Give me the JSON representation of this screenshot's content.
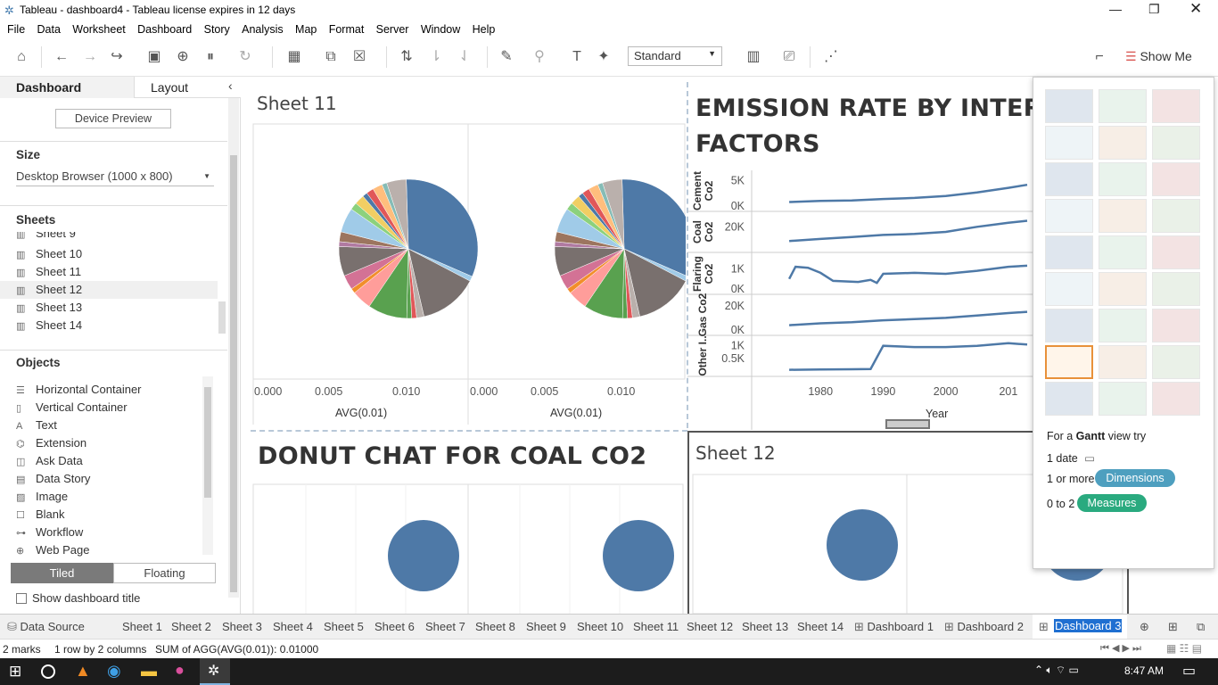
{
  "window": {
    "title": "Tableau - dashboard4 - Tableau license expires in 12 days"
  },
  "menu": [
    "File",
    "Data",
    "Worksheet",
    "Dashboard",
    "Story",
    "Analysis",
    "Map",
    "Format",
    "Server",
    "Window",
    "Help"
  ],
  "toolbar": {
    "view_mode": "Standard",
    "show_me_label": "Show Me"
  },
  "left_panel": {
    "tabs": [
      "Dashboard",
      "Layout"
    ],
    "device_preview": "Device Preview",
    "size_header": "Size",
    "size_value": "Desktop Browser (1000 x 800)",
    "sheets_header": "Sheets",
    "sheets": [
      "Sheet 9",
      "Sheet 10",
      "Sheet 11",
      "Sheet 12",
      "Sheet 13",
      "Sheet 14"
    ],
    "objects_header": "Objects",
    "objects": [
      "Horizontal Container",
      "Vertical Container",
      "Text",
      "Extension",
      "Ask Data",
      "Data Story",
      "Image",
      "Blank",
      "Workflow",
      "Web Page"
    ],
    "tiled": "Tiled",
    "floating": "Floating",
    "show_title": "Show dashboard title"
  },
  "dashboard": {
    "sheet11_title": "Sheet 11",
    "emission_title_line1": "EMISSION RATE BY INTERNA",
    "emission_title_line2": "FACTORS",
    "donut_title": "DONUT CHAT FOR COAL CO2",
    "sheet12_title": "Sheet 12",
    "pie_axis_ticks": [
      "0.000",
      "0.005",
      "0.010"
    ],
    "pie_axis_label": "AVG(0.01)",
    "year_label": "Year",
    "year_ticks": [
      "1980",
      "1990",
      "2000",
      "201"
    ]
  },
  "chart_data": {
    "type": "line",
    "xlabel": "Year",
    "series": [
      {
        "name": "Cement Co2",
        "ticks": [
          "5K",
          "0K"
        ],
        "values": [
          {
            "x": 1975,
            "y": 800
          },
          {
            "x": 1980,
            "y": 1000
          },
          {
            "x": 1985,
            "y": 1100
          },
          {
            "x": 1990,
            "y": 1400
          },
          {
            "x": 1995,
            "y": 1600
          },
          {
            "x": 2000,
            "y": 2000
          },
          {
            "x": 2005,
            "y": 2700
          },
          {
            "x": 2010,
            "y": 3600
          },
          {
            "x": 2013,
            "y": 4200
          }
        ]
      },
      {
        "name": "Coal Co2",
        "ticks": [
          "20K"
        ],
        "values": [
          {
            "x": 1975,
            "y": 13000
          },
          {
            "x": 1980,
            "y": 14000
          },
          {
            "x": 1985,
            "y": 15000
          },
          {
            "x": 1990,
            "y": 16000
          },
          {
            "x": 1995,
            "y": 16500
          },
          {
            "x": 2000,
            "y": 17500
          },
          {
            "x": 2005,
            "y": 20000
          },
          {
            "x": 2010,
            "y": 22000
          },
          {
            "x": 2013,
            "y": 23000
          }
        ]
      },
      {
        "name": "Flaring Co2",
        "ticks": [
          "1K",
          "0K"
        ],
        "values": [
          {
            "x": 1975,
            "y": 500
          },
          {
            "x": 1976,
            "y": 1100
          },
          {
            "x": 1978,
            "y": 1050
          },
          {
            "x": 1980,
            "y": 800
          },
          {
            "x": 1982,
            "y": 400
          },
          {
            "x": 1986,
            "y": 350
          },
          {
            "x": 1988,
            "y": 450
          },
          {
            "x": 1989,
            "y": 300
          },
          {
            "x": 1990,
            "y": 750
          },
          {
            "x": 1995,
            "y": 800
          },
          {
            "x": 2000,
            "y": 750
          },
          {
            "x": 2005,
            "y": 900
          },
          {
            "x": 2010,
            "y": 1100
          },
          {
            "x": 2013,
            "y": 1150
          }
        ]
      },
      {
        "name": "Gas Co2",
        "ticks": [
          "20K",
          "0K"
        ],
        "values": [
          {
            "x": 1975,
            "y": 4000
          },
          {
            "x": 1980,
            "y": 5500
          },
          {
            "x": 1985,
            "y": 6500
          },
          {
            "x": 1990,
            "y": 8000
          },
          {
            "x": 1995,
            "y": 9000
          },
          {
            "x": 2000,
            "y": 10000
          },
          {
            "x": 2005,
            "y": 12000
          },
          {
            "x": 2010,
            "y": 14000
          },
          {
            "x": 2013,
            "y": 15000
          }
        ]
      },
      {
        "name": "Other I..",
        "ticks": [
          "1K",
          "0.5K"
        ],
        "values": [
          {
            "x": 1975,
            "y": 50
          },
          {
            "x": 1980,
            "y": 60
          },
          {
            "x": 1985,
            "y": 70
          },
          {
            "x": 1988,
            "y": 80
          },
          {
            "x": 1990,
            "y": 1000
          },
          {
            "x": 1995,
            "y": 950
          },
          {
            "x": 2000,
            "y": 950
          },
          {
            "x": 2005,
            "y": 1000
          },
          {
            "x": 2010,
            "y": 1100
          },
          {
            "x": 2013,
            "y": 1050
          }
        ]
      }
    ]
  },
  "show_me": {
    "hint_prefix": "For a",
    "hint_chart": "Gantt",
    "hint_suffix": "view try",
    "req1": "1 date",
    "req2": "1 or more",
    "req2_pill": "Dimensions",
    "req3": "0 to 2",
    "req3_pill": "Measures",
    "dim_color": "#4e9fbf",
    "meas_color": "#2aaa7f"
  },
  "bottom_tabs": [
    "Data Source",
    "Sheet 1",
    "Sheet 2",
    "Sheet 3",
    "Sheet 4",
    "Sheet 5",
    "Sheet 6",
    "Sheet 7",
    "Sheet 8",
    "Sheet 9",
    "Sheet 10",
    "Sheet 11",
    "Sheet 12",
    "Sheet 13",
    "Sheet 14",
    "Dashboard 1",
    "Dashboard 2",
    "Dashboard 3"
  ],
  "status": {
    "marks": "2 marks",
    "rows": "1 row by 2 columns",
    "sum": "SUM of AGG(AVG(0.01)): 0.01000"
  },
  "taskbar": {
    "time": "8:47 AM"
  }
}
